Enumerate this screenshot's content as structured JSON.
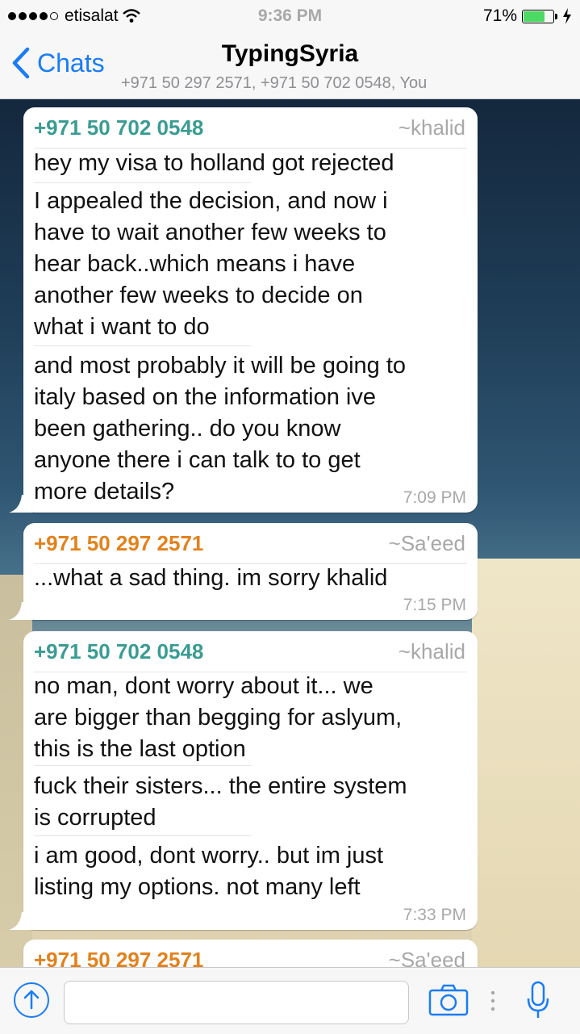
{
  "status": {
    "carrier": "etisalat",
    "time": "9:36 PM",
    "battery": "71%",
    "battery_level": 0.71
  },
  "nav": {
    "back_label": "Chats",
    "title": "TypingSyria",
    "subtitle": "+971 50 297 2571, +971 50 702 0548, You"
  },
  "messages": [
    {
      "sender": "+971 50 702 0548",
      "alias": "~khalid",
      "texts": [
        [
          "hey my visa to holland got rejected"
        ],
        [
          "I appealed the decision, and now i",
          "have to wait another few weeks to",
          "hear back..which means i have",
          "another few weeks to decide on",
          "what i want to do"
        ],
        [
          "and most probably it will be going to",
          "italy based on the information ive",
          "been gathering.. do you know",
          "anyone there i can talk to to get",
          "more details?"
        ]
      ],
      "time": "7:09 PM"
    },
    {
      "sender": "+971 50 297 2571",
      "alias": "~Sa'eed",
      "texts": [
        [
          "...what a sad thing. im sorry khalid"
        ]
      ],
      "time": "7:15 PM"
    },
    {
      "sender": "+971 50 702 0548",
      "alias": "~khalid",
      "texts": [
        [
          "no man, dont worry about it... we",
          "are bigger than begging for aslyum,",
          "this is the last option"
        ],
        [
          "fuck their sisters... the entire system",
          "is corrupted"
        ],
        [
          "i am good, dont worry.. but im just",
          "listing my options. not many left"
        ]
      ],
      "time": "7:33 PM"
    },
    {
      "sender": "+971 50 297 2571",
      "alias": "~Sa'eed",
      "texts": [],
      "time": ""
    }
  ],
  "input": {
    "placeholder": ""
  },
  "icons": {
    "back": "chevron-left-icon",
    "upload": "upload-arrow-icon",
    "camera": "camera-icon",
    "mic": "microphone-icon",
    "wifi": "wifi-icon",
    "charging": "lightning-icon"
  },
  "colors": {
    "accent": "#1a7cf5",
    "sender_khalid": "#3a9c93",
    "sender_saeed": "#e3811b"
  }
}
